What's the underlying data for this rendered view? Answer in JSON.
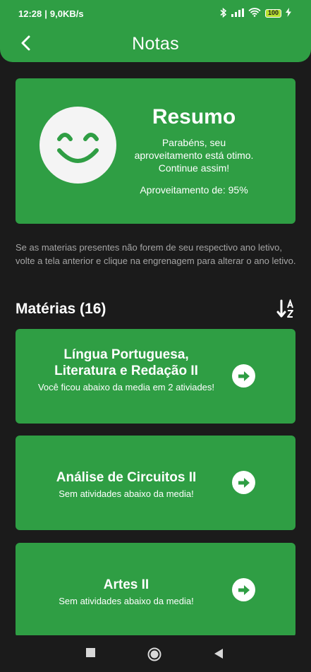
{
  "status_bar": {
    "time": "12:28",
    "speed": "9,0KB/s",
    "battery": "100"
  },
  "header": {
    "title": "Notas"
  },
  "summary": {
    "title": "Resumo",
    "message": "Parabéns, seu aproveitamento está otimo. Continue assim!",
    "performance": "Aproveitamento de: 95%"
  },
  "info_text": "Se as materias presentes não forem de seu respectivo ano letivo, volte a tela anterior e clique na engrenagem para alterar o ano letivo.",
  "section": {
    "title": "Matérias (16)"
  },
  "subjects": [
    {
      "name": "Língua Portuguesa, Literatura e Redação  II",
      "note": "Você ficou abaixo da media em 2 ativiades!"
    },
    {
      "name": "Análise de Circuitos II",
      "note": "Sem atividades abaixo da media!"
    },
    {
      "name": "Artes II",
      "note": "Sem atividades abaixo da media!"
    }
  ],
  "colors": {
    "primary": "#2f9e44",
    "background": "#1b1b1b"
  }
}
